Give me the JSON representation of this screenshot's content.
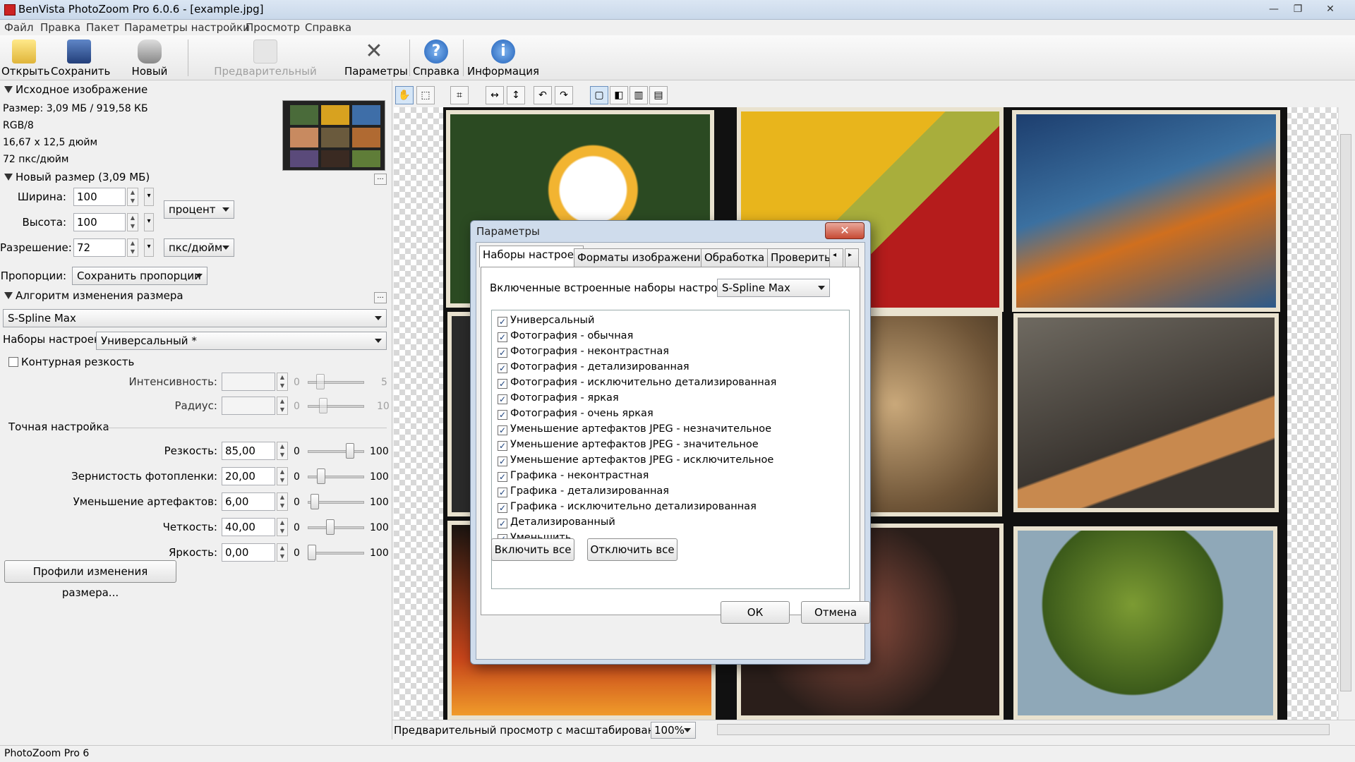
{
  "window": {
    "title": "BenVista PhotoZoom Pro 6.0.6 - [example.jpg]",
    "controls": {
      "minimize": "—",
      "maximize": "❐",
      "close": "✕"
    }
  },
  "menu": [
    "Файл",
    "Правка",
    "Пакет",
    "Параметры настройки",
    "Просмотр",
    "Справка"
  ],
  "toolbar": {
    "open": "Открыть",
    "save": "Сохранить",
    "new_batch": "Новый пакет",
    "preview": "Предварительный просмотр",
    "settings": "Параметры",
    "help": "Справка",
    "info": "Информация"
  },
  "source": {
    "header": "Исходное изображение",
    "size": "Размер: 3,09 МБ / 919,58 КБ",
    "mode": "RGB/8",
    "dimensions": "16,67 x 12,5 дюйм",
    "dpi": "72 пкс/дюйм"
  },
  "new_size": {
    "header": "Новый размер (3,09 МБ)",
    "width_label": "Ширина:",
    "width_value": "100",
    "height_label": "Высота:",
    "height_value": "100",
    "unit": "процент",
    "res_label": "Разрешение:",
    "res_value": "72",
    "res_unit": "пкс/дюйм",
    "prop_label": "Пропорции:",
    "prop_value": "Сохранить пропорции"
  },
  "algorithm": {
    "header": "Алгоритм изменения размера",
    "method": "S-Spline Max",
    "presets_label": "Наборы настроек:",
    "presets_value": "Универсальный *"
  },
  "unsharp": {
    "label": "Контурная резкость",
    "intensity_label": "Интенсивность:",
    "intensity_min": "0",
    "intensity_max": "5",
    "radius_label": "Радиус:",
    "radius_min": "0",
    "radius_max": "10"
  },
  "fine_tune": {
    "header": "Точная настройка",
    "rows": [
      {
        "label": "Резкость:",
        "value": "85,00",
        "min": "0",
        "max": "100",
        "level": 0.85
      },
      {
        "label": "Зернистость фотопленки:",
        "value": "20,00",
        "min": "0",
        "max": "100",
        "level": 0.2
      },
      {
        "label": "Уменьшение артефактов:",
        "value": "6,00",
        "min": "0",
        "max": "100",
        "level": 0.06
      },
      {
        "label": "Четкость:",
        "value": "40,00",
        "min": "0",
        "max": "100",
        "level": 0.4
      },
      {
        "label": "Яркость:",
        "value": "0,00",
        "min": "0",
        "max": "100",
        "level": 0.0
      }
    ],
    "profiles_button": "Профили изменения размера..."
  },
  "preview_bar": {
    "label": "Предварительный просмотр с масштабированием:",
    "zoom": "100%"
  },
  "status": "PhotoZoom Pro 6",
  "dialog": {
    "title": "Параметры",
    "close": "✕",
    "tabs": [
      "Наборы настроек",
      "Форматы изображений",
      "Обработка",
      "Проверить"
    ],
    "presets_for_label": "Включенные встроенные наборы настроек для:",
    "presets_for_value": "S-Spline Max",
    "items": [
      "Универсальный",
      "Фотография - обычная",
      "Фотография - неконтрастная",
      "Фотография - детализированная",
      "Фотография - исключительно детализированная",
      "Фотография - яркая",
      "Фотография - очень яркая",
      "Уменьшение артефактов JPEG - незначительное",
      "Уменьшение артефактов JPEG - значительное",
      "Уменьшение артефактов JPEG - исключительное",
      "Графика - неконтрастная",
      "Графика - детализированная",
      "Графика - исключительно детализированная",
      "Детализированный",
      "Уменьшить"
    ],
    "enable_all": "Включить все",
    "disable_all": "Отключить все",
    "ok": "ОК",
    "cancel": "Отмена"
  }
}
